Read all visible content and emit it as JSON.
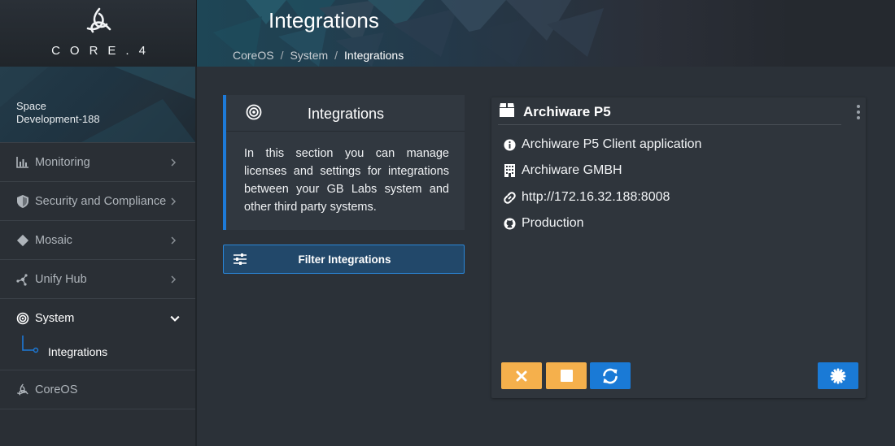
{
  "brand": {
    "logo_text": "CORE.4"
  },
  "header": {
    "title": "Integrations",
    "breadcrumb": [
      "CoreOS",
      "System",
      "Integrations"
    ],
    "separator": "/"
  },
  "sidebar": {
    "space_label": "Space",
    "space_name": "Development-188",
    "items": [
      {
        "label": "Monitoring",
        "icon": "bar-chart-icon"
      },
      {
        "label": "Security and Compliance",
        "icon": "shield-icon"
      },
      {
        "label": "Mosaic",
        "icon": "diamond-icon"
      },
      {
        "label": "Unify Hub",
        "icon": "hub-nodes-icon"
      },
      {
        "label": "System",
        "icon": "target-icon",
        "expanded": true
      },
      {
        "label": "CoreOS",
        "icon": "core-logo-icon"
      }
    ],
    "sub_item": {
      "label": "Integrations"
    }
  },
  "info": {
    "title": "Integrations",
    "text": "In this section you can manage licenses and settings for integrations between your GB Labs system and other third party systems."
  },
  "filter": {
    "label": "Filter Integrations"
  },
  "card": {
    "title": "Archiware P5",
    "description": "Archiware P5 Client application",
    "company": "Archiware GMBH",
    "url": "http://172.16.32.188:8008",
    "environment": "Production"
  },
  "colors": {
    "accent": "#1d7ad8",
    "warning_button": "#f5b04c",
    "primary_button": "#1a7ad6",
    "background": "#2b3138"
  }
}
